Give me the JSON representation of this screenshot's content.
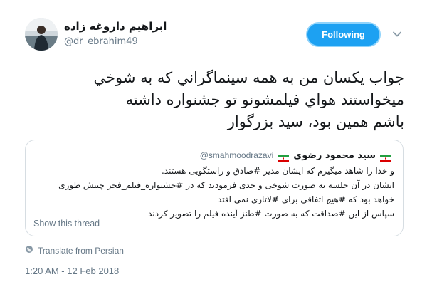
{
  "author": {
    "name": "ابراهیم داروغه زاده",
    "handle": "@dr_ebrahim49"
  },
  "follow_button": {
    "label": "Following"
  },
  "tweet": {
    "lines": [
      "جواب يكسان من به همه سينماگراني كه به شوخي",
      "ميخواستند هواي فيلمشونو تو جشنواره داشته",
      "باشم همين بود،  سيد بزرگوار"
    ]
  },
  "quoted_tweet": {
    "name": "سید محمود رضوی",
    "handle": "@smahmoodrazavi",
    "lines": [
      "و خدا را شاهد میگیرم که ایشان مدیر #صادق و راستگویی هستند.",
      "ایشان در آن جلسه به صورت شوخی و جدی فرمودند که در #جشنواره_فیلم_فجر چینش طوری",
      "خواهد بود که #هیچ اتفاقی برای #لاتاری نمی افتد",
      "سپاس از این #صداقت که به صورت #طنز آینده فیلم را تصویر کردند"
    ],
    "show_thread": "Show this thread"
  },
  "translate_label": "Translate from Persian",
  "timestamp": "1:20 AM - 12 Feb 2018",
  "colors": {
    "accent": "#1da1f2",
    "text": "#14171a",
    "muted": "#657786",
    "border": "#d6dde2"
  },
  "icons": {
    "chevron": "chevron-down-icon",
    "globe": "globe-icon",
    "flag": "iran-flag-icon"
  }
}
